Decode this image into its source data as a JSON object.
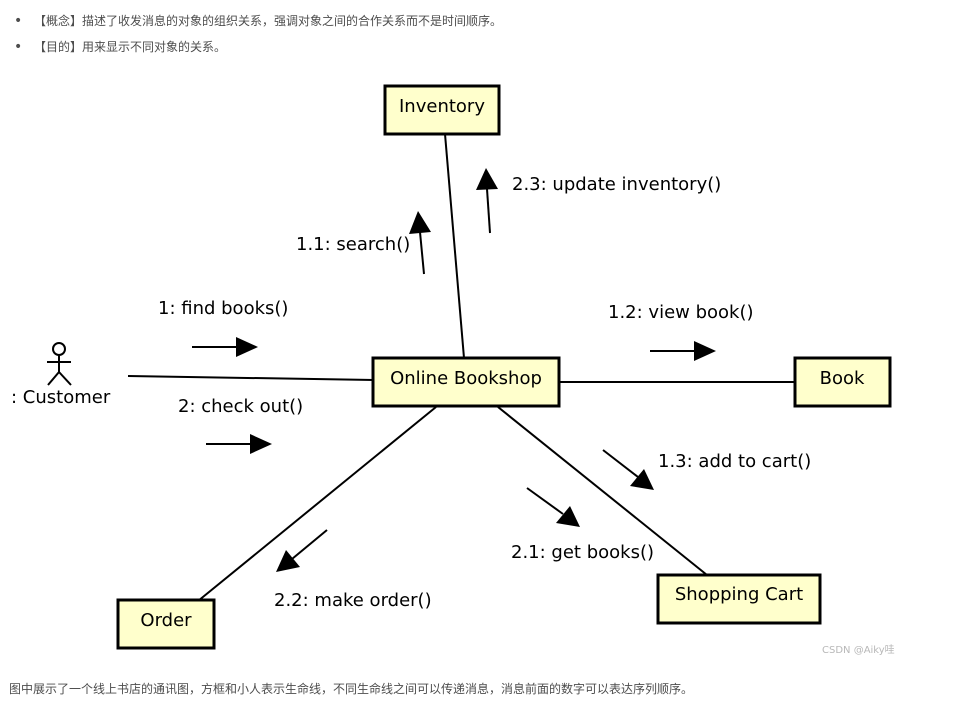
{
  "bullets": [
    "【概念】描述了收发消息的对象的组织关系，强调对象之间的合作关系而不是时间顺序。",
    "【目的】用来显示不同对象的关系。"
  ],
  "diagram": {
    "actor": {
      "label": ": Customer"
    },
    "objects": {
      "inventory": "Inventory",
      "bookshop": "Online Bookshop",
      "book": "Book",
      "order": "Order",
      "cart": "Shopping Cart"
    },
    "messages": {
      "find_books": "1: find books()",
      "search": "1.1: search()",
      "view_book": "1.2: view book()",
      "add_to_cart": "1.3: add to cart()",
      "check_out": "2: check out()",
      "get_books": "2.1: get books()",
      "make_order": "2.2: make order()",
      "update_inventory": "2.3: update inventory()"
    },
    "colors": {
      "object_fill": "#ffffcc",
      "stroke": "#000000"
    }
  },
  "watermark": "CSDN @Aiky哇",
  "caption": "图中展示了一个线上书店的通讯图，方框和小人表示生命线，不同生命线之间可以传递消息，消息前面的数字可以表达序列顺序。"
}
